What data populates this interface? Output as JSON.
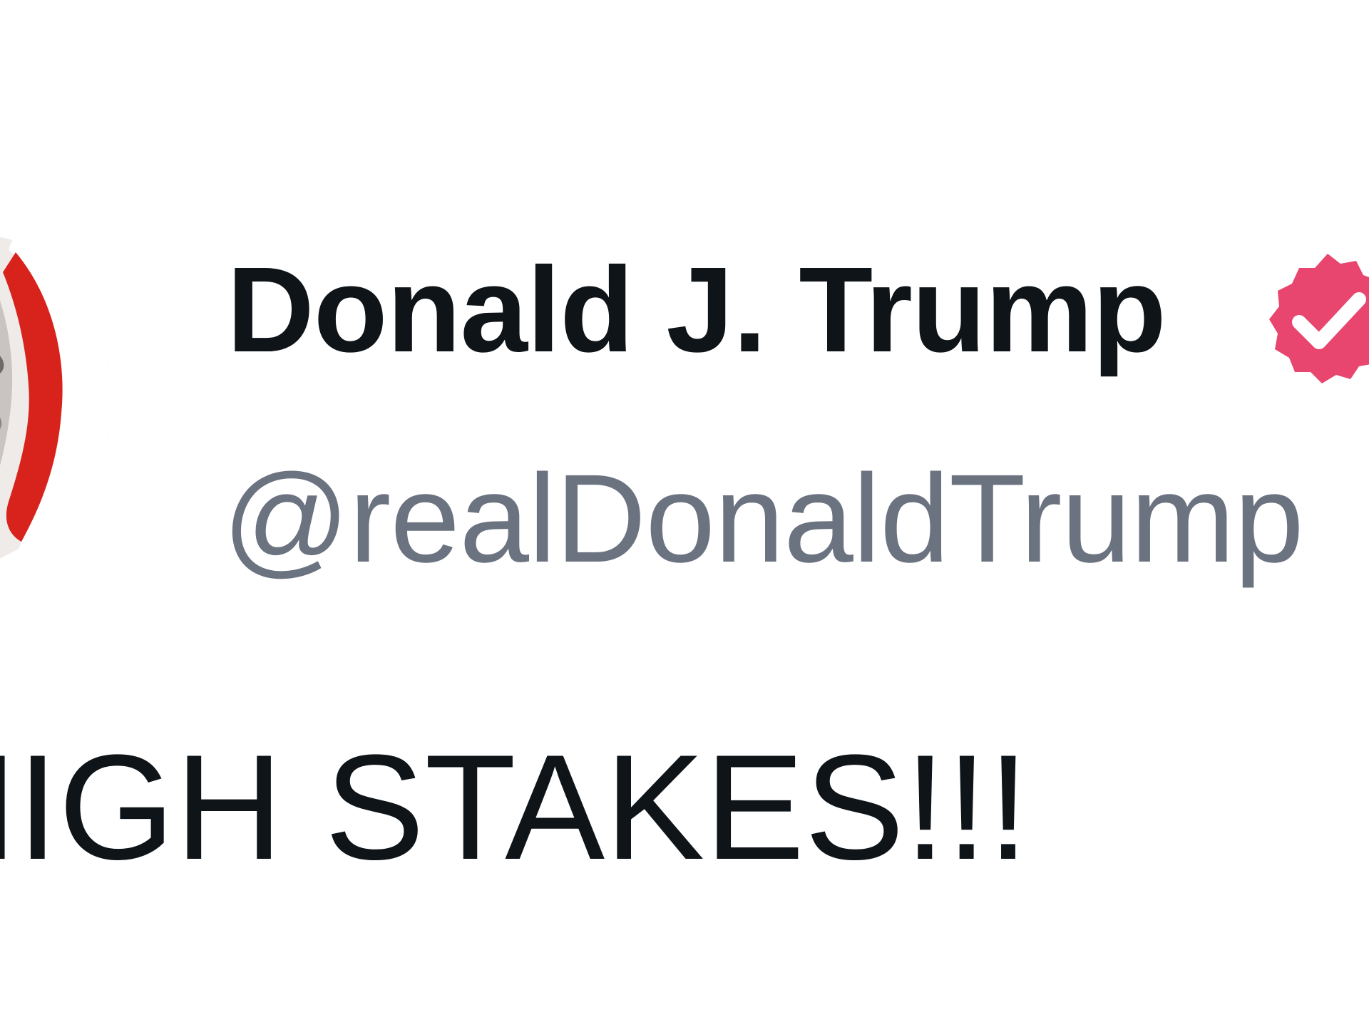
{
  "post": {
    "author": {
      "display_name": "Donald J. Trump",
      "handle": "@realDonaldTrump",
      "verified": true,
      "verified_icon": "verified-badge-icon",
      "badge_color": "#e8466f"
    },
    "text": "HIGH STAKES!!!"
  },
  "colors": {
    "name": "#0f1419",
    "handle": "#6b7280",
    "background": "#ffffff",
    "avatar_accent": "#d8221c"
  }
}
